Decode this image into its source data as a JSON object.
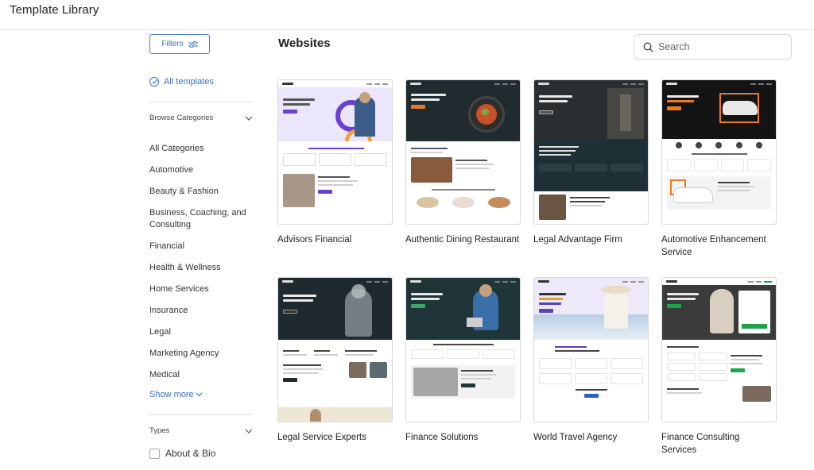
{
  "app": {
    "title": "Template Library"
  },
  "sidebar": {
    "filters_label": "Filters",
    "all_templates_label": "All templates",
    "browse_categories_label": "Browse Categories",
    "categories": [
      "All Categories",
      "Automotive",
      "Beauty & Fashion",
      "Business, Coaching, and Consulting",
      "Financial",
      "Health & Wellness",
      "Home Services",
      "Insurance",
      "Legal",
      "Marketing Agency",
      "Medical"
    ],
    "show_more_label": "Show more",
    "types_label": "Types",
    "types": [
      "About & Bio"
    ]
  },
  "main": {
    "section_title": "Websites",
    "search_placeholder": "Search",
    "templates": [
      {
        "name": "Advisors Financial"
      },
      {
        "name": "Authentic Dining Restaurant"
      },
      {
        "name": "Legal Advantage Firm"
      },
      {
        "name": "Automotive Enhancement Service"
      },
      {
        "name": "Legal Service Experts"
      },
      {
        "name": "Finance Solutions"
      },
      {
        "name": "World Travel Agency"
      },
      {
        "name": "Finance Consulting Services"
      }
    ]
  },
  "colors": {
    "accent": "#3a6fc9",
    "advisors_hero": "#e8e2fb",
    "advisors_accent": "#6a3fd6",
    "dining_hero": "#1f2b2f",
    "legal_hero": "#1e2a2f",
    "auto_hero": "#141414",
    "auto_accent": "#f07a1a",
    "finance_hero": "#1f3538",
    "travel_hero": "#e9e4f6",
    "consulting_green": "#1ea34a"
  }
}
